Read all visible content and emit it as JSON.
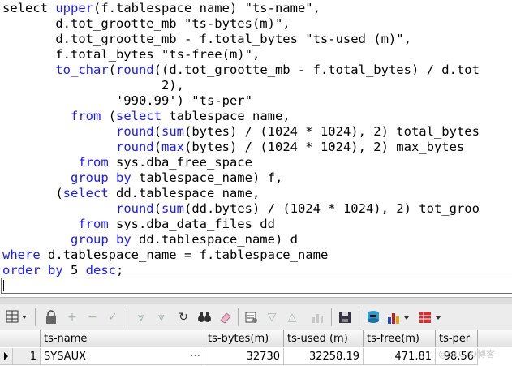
{
  "editor": {
    "lines": [
      [
        "select ",
        "upper",
        "(f.tablespace_name) \"ts-name\","
      ],
      [
        "       d.tot_grootte_mb \"ts-bytes(m)\","
      ],
      [
        "       d.tot_grootte_mb - f.total_bytes \"ts-used (m)\","
      ],
      [
        "       f.total_bytes \"ts-free(m)\","
      ],
      [
        "       ",
        "to_char",
        "(",
        "round",
        "((d.tot_grootte_mb - f.total_bytes) / d.tot"
      ],
      [
        "                     2),"
      ],
      [
        "               '990.99') \"ts-per\""
      ],
      [
        "         ",
        "from",
        " (",
        "select",
        " tablespace_name,"
      ],
      [
        "               ",
        "round",
        "(",
        "sum",
        "(bytes) / (1024 * 1024), 2) total_bytes"
      ],
      [
        "               ",
        "round",
        "(",
        "max",
        "(bytes) / (1024 * 1024), 2) max_bytes"
      ],
      [
        "          ",
        "from",
        " sys.dba_free_space"
      ],
      [
        "         ",
        "group by",
        " tablespace_name) f,"
      ],
      [
        "       (",
        "select",
        " dd.tablespace_name,"
      ],
      [
        "               ",
        "round",
        "(",
        "sum",
        "(dd.bytes) / (1024 * 1024), 2) tot_groo"
      ],
      [
        "          ",
        "from",
        " sys.dba_data_files dd"
      ],
      [
        "         ",
        "group by",
        " dd.tablespace_name) d"
      ],
      [
        "where",
        " d.tablespace_name = f.tablespace_name"
      ],
      [
        "order by",
        " 5 ",
        "desc",
        ";"
      ]
    ],
    "kw_color": "#1a1aff"
  },
  "grid": {
    "columns": [
      "ts-name",
      "ts-bytes(m)",
      "ts-used (m)",
      "ts-free(m)",
      "ts-per"
    ],
    "rows": [
      {
        "index": "1",
        "ts_name": "SYSAUX",
        "ts_bytes": "32730",
        "ts_used": "32258.19",
        "ts_free": "471.81",
        "ts_per": "98.56"
      }
    ],
    "ellipsis": "…"
  },
  "watermark": "@51CTO博客"
}
